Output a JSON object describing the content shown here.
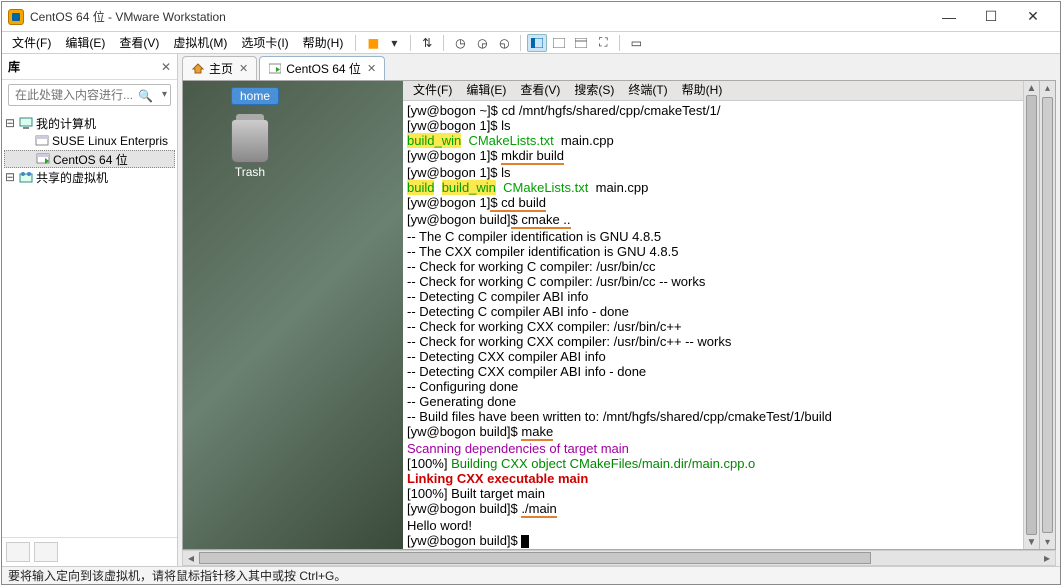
{
  "titlebar": {
    "title": "CentOS 64 位 - VMware Workstation"
  },
  "menus": {
    "file": "文件(F)",
    "edit": "编辑(E)",
    "view": "查看(V)",
    "vm": "虚拟机(M)",
    "tabs": "选项卡(I)",
    "help": "帮助(H)"
  },
  "sidebar": {
    "title": "库",
    "search_placeholder": "在此处键入内容进行...",
    "root": "我的计算机",
    "items": [
      "SUSE Linux Enterpris",
      "CentOS 64 位"
    ],
    "shared": "共享的虚拟机"
  },
  "tabs": {
    "home": "主页",
    "active": "CentOS 64 位"
  },
  "desktop": {
    "home": "home",
    "trash": "Trash"
  },
  "term_menu": {
    "file": "文件(F)",
    "edit": "编辑(E)",
    "view": "查看(V)",
    "search": "搜索(S)",
    "terminal": "终端(T)",
    "help": "帮助(H)"
  },
  "term": {
    "l1_prompt": "[yw@bogon ~]$ ",
    "l1_cmd": "cd /mnt/hgfs/shared/cpp/cmakeTest/1/",
    "l2_prompt": "[yw@bogon 1]$ ",
    "l2_cmd": "ls",
    "l3_a": "build_win",
    "l3_b": "CMakeLists.txt",
    "l3_c": "main.cpp",
    "l4_prompt": "[yw@bogon 1]$ ",
    "l4_cmd": "mkdir build",
    "l5_prompt": "[yw@bogon 1]$ ",
    "l5_cmd": "ls",
    "l6_a": "build",
    "l6_b": "build_win",
    "l6_c": "CMakeLists.txt",
    "l6_d": "main.cpp",
    "l7_prompt": "[yw@bogon 1]",
    "l7_cmd": "$ cd build",
    "l8_prompt": "[yw@bogon build]",
    "l8_cmd": "$ cmake ..",
    "c1": "-- The C compiler identification is GNU 4.8.5",
    "c2": "-- The CXX compiler identification is GNU 4.8.5",
    "c3": "-- Check for working C compiler: /usr/bin/cc",
    "c4": "-- Check for working C compiler: /usr/bin/cc -- works",
    "c5": "-- Detecting C compiler ABI info",
    "c6": "-- Detecting C compiler ABI info - done",
    "c7": "-- Check for working CXX compiler: /usr/bin/c++",
    "c8": "-- Check for working CXX compiler: /usr/bin/c++ -- works",
    "c9": "-- Detecting CXX compiler ABI info",
    "c10": "-- Detecting CXX compiler ABI info - done",
    "c11": "-- Configuring done",
    "c12": "-- Generating done",
    "c13": "-- Build files have been written to: /mnt/hgfs/shared/cpp/cmakeTest/1/build",
    "m_prompt": "[yw@bogon build]$ ",
    "m_cmd": "make",
    "s1": "Scanning dependencies of target main",
    "s2a": "[100%] ",
    "s2b": "Building CXX object CMakeFiles/main.dir/main.cpp.o",
    "s3": "Linking CXX executable main",
    "s4": "[100%] Built target main",
    "r_prompt": "[yw@bogon build]$ ",
    "r_cmd": "./main",
    "out": "Hello word!",
    "last_prompt": "[yw@bogon build]$ "
  },
  "status": "要将输入定向到该虚拟机，请将鼠标指针移入其中或按 Ctrl+G。"
}
